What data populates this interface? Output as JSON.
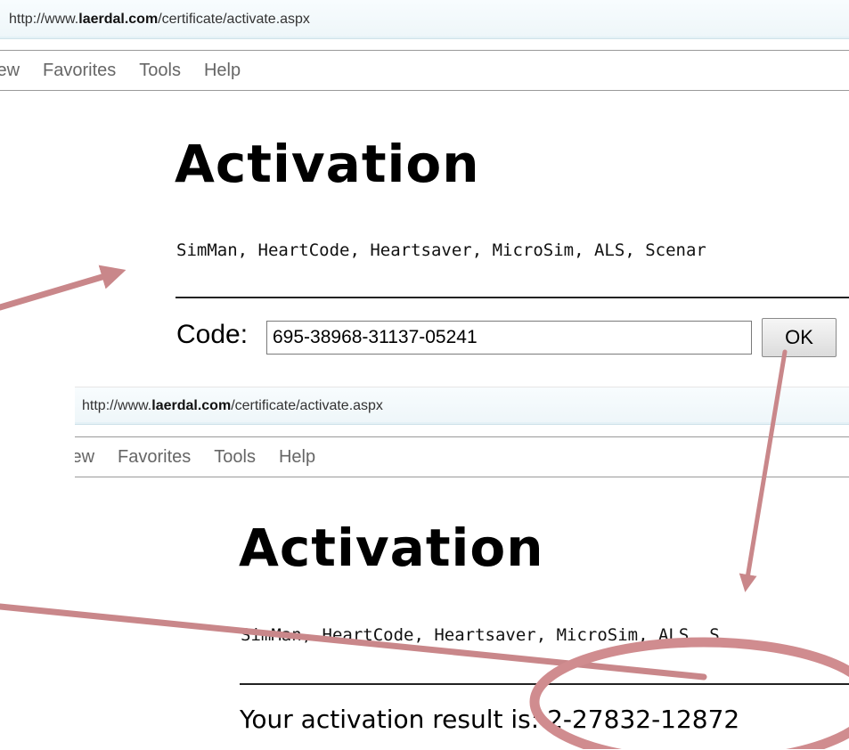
{
  "screen1": {
    "address": {
      "prefix": "http://www.",
      "domain": "laerdal.com",
      "path": "/certificate/activate.aspx"
    },
    "menu": [
      "iew",
      "Favorites",
      "Tools",
      "Help"
    ],
    "heading": "Activation",
    "products": "SimMan, HeartCode, Heartsaver, MicroSim, ALS, Scenar",
    "code_label": "Code:",
    "code_value": "695-38968-31137-05241",
    "ok_label": "OK"
  },
  "screen2": {
    "address": {
      "prefix": "http://www.",
      "domain": "laerdal.com",
      "path": "/certificate/activate.aspx"
    },
    "menu": [
      "iew",
      "Favorites",
      "Tools",
      "Help"
    ],
    "heading": "Activation",
    "products": "SimMan, HeartCode, Heartsaver, MicroSim, ALS, S",
    "result_label": "Your activation result is:",
    "result_value": "2-27832-12872"
  },
  "annotations": {
    "arrow_color": "#c9878a",
    "highlight_color": "#d08c8f"
  }
}
